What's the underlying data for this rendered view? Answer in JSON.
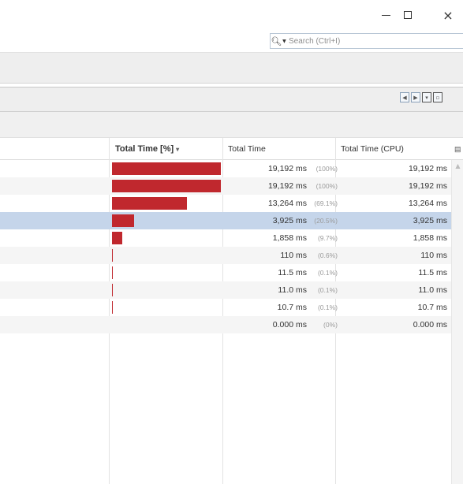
{
  "window": {
    "minimize_label": "—",
    "close_label": "×"
  },
  "search": {
    "placeholder": "Search (Ctrl+I)"
  },
  "table": {
    "columns": [
      "Total Time [%]",
      "Total Time",
      "Total Time (CPU)"
    ],
    "sort_indicator": "▾",
    "rows": [
      {
        "percent_fraction": 1.0,
        "time": "19,192 ms",
        "pct": "(100%)",
        "cpu": "19,192 ms",
        "selected": false
      },
      {
        "percent_fraction": 1.0,
        "time": "19,192 ms",
        "pct": "(100%)",
        "cpu": "19,192 ms",
        "selected": false
      },
      {
        "percent_fraction": 0.691,
        "time": "13,264 ms",
        "pct": "(69.1%)",
        "cpu": "13,264 ms",
        "selected": false
      },
      {
        "percent_fraction": 0.205,
        "time": "3,925 ms",
        "pct": "(20.5%)",
        "cpu": "3,925 ms",
        "selected": true
      },
      {
        "percent_fraction": 0.097,
        "time": "1,858 ms",
        "pct": "(9.7%)",
        "cpu": "1,858 ms",
        "selected": false
      },
      {
        "percent_fraction": 0.006,
        "time": "110 ms",
        "pct": "(0.6%)",
        "cpu": "110 ms",
        "selected": false
      },
      {
        "percent_fraction": 0.001,
        "time": "11.5 ms",
        "pct": "(0.1%)",
        "cpu": "11.5 ms",
        "selected": false
      },
      {
        "percent_fraction": 0.001,
        "time": "11.0 ms",
        "pct": "(0.1%)",
        "cpu": "11.0 ms",
        "selected": false
      },
      {
        "percent_fraction": 0.001,
        "time": "10.7 ms",
        "pct": "(0.1%)",
        "cpu": "10.7 ms",
        "selected": false
      },
      {
        "percent_fraction": 0.0,
        "time": "0.000 ms",
        "pct": "(0%)",
        "cpu": "0.000 ms",
        "selected": false
      }
    ]
  },
  "colors": {
    "bar": "#c0282e",
    "selection": "#c5d5ea"
  }
}
